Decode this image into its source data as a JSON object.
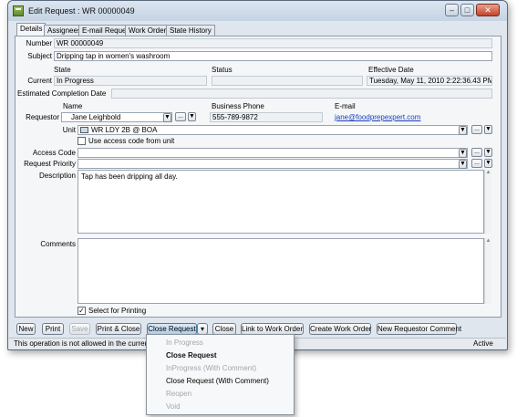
{
  "window": {
    "title": "Edit Request : WR 00000049"
  },
  "tabs": [
    "Details",
    "Assignees",
    "E-mail Request",
    "Work Orders",
    "State History"
  ],
  "form": {
    "number_label": "Number",
    "number": "WR 00000049",
    "subject_label": "Subject",
    "subject": "Dripping tap in women's washroom",
    "state_header": "State",
    "status_header": "Status",
    "effective_header": "Effective Date",
    "current_label": "Current",
    "state": "In Progress",
    "status": "",
    "effective_date": "Tuesday, May 11, 2010 2:22:36.43 PM",
    "est_completion_label": "Estimated Completion Date",
    "est_completion": "",
    "name_header": "Name",
    "phone_header": "Business Phone",
    "email_header": "E-mail",
    "requestor_label": "Requestor",
    "requestor_name": "Jane Leighbold",
    "requestor_phone": "555-789-9872",
    "requestor_email": "jane@foodprepexpert.com",
    "unit_label": "Unit",
    "unit": "WR LDY 2B @ BOA",
    "use_access_label": "Use access code from unit",
    "access_code_label": "Access Code",
    "access_code": "",
    "priority_label": "Request Priority",
    "priority": "",
    "description_label": "Description",
    "description": "Tap has been dripping all day.",
    "comments_label": "Comments",
    "comments": "",
    "select_printing_label": "Select for Printing",
    "ellipsis": "...",
    "dropdown_glyph": "▼"
  },
  "buttons": {
    "new": "New",
    "print": "Print",
    "save": "Save",
    "print_close": "Print & Close",
    "close_request": "Close Request",
    "close": "Close",
    "link_wo": "Link to Work Order",
    "create_wo": "Create Work Order",
    "new_requestor_comment": "New Requestor Comment"
  },
  "status": {
    "message": "This operation is not allowed in the current state",
    "mode": "Active"
  },
  "menu": [
    {
      "label": "In Progress",
      "state": "disabled"
    },
    {
      "label": "Close Request",
      "state": "bold"
    },
    {
      "label": "InProgress (With Comment)",
      "state": "disabled"
    },
    {
      "label": "Close Request (With Comment)",
      "state": "normal"
    },
    {
      "label": "Reopen",
      "state": "disabled"
    },
    {
      "label": "Void",
      "state": "disabled"
    }
  ]
}
